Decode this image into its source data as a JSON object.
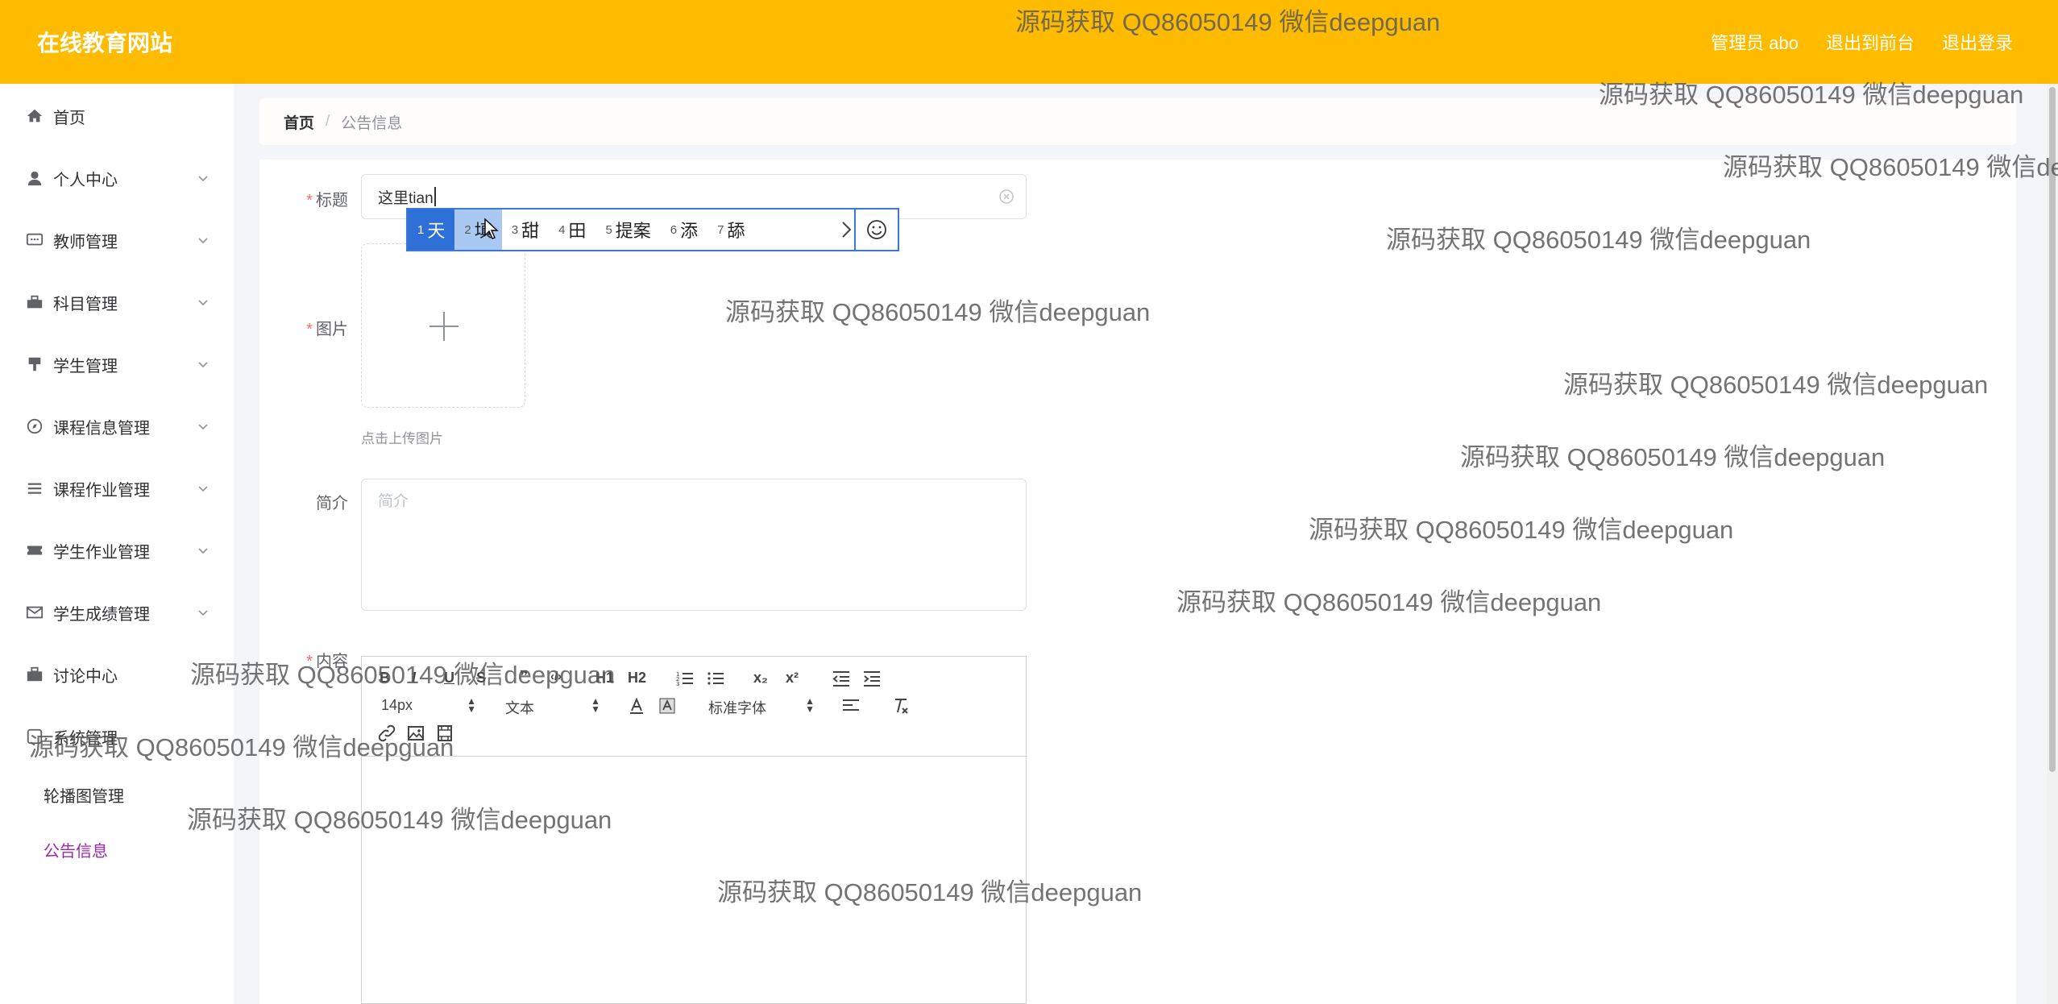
{
  "header": {
    "site_title": "在线教育网站",
    "nav": [
      "管理员 abo",
      "退出到前台",
      "退出登录"
    ]
  },
  "sidebar": {
    "items": [
      {
        "label": "首页",
        "icon": "home-icon"
      },
      {
        "label": "个人中心",
        "icon": "user-icon"
      },
      {
        "label": "教师管理",
        "icon": "chat-icon"
      },
      {
        "label": "科目管理",
        "icon": "briefcase-icon"
      },
      {
        "label": "学生管理",
        "icon": "chair-icon"
      },
      {
        "label": "课程信息管理",
        "icon": "compass-icon"
      },
      {
        "label": "课程作业管理",
        "icon": "list-icon"
      },
      {
        "label": "学生作业管理",
        "icon": "ticket-icon"
      },
      {
        "label": "学生成绩管理",
        "icon": "mail-icon"
      },
      {
        "label": "讨论中心",
        "icon": "bag-icon"
      },
      {
        "label": "系统管理",
        "icon": "settings-icon"
      }
    ],
    "sub_items": [
      "轮播图管理",
      "公告信息"
    ]
  },
  "breadcrumb": {
    "home": "首页",
    "separator": "/",
    "current": "公告信息"
  },
  "form": {
    "title_label": "标题",
    "title_value": "这里tian",
    "image_label": "图片",
    "upload_hint": "点击上传图片",
    "intro_label": "简介",
    "intro_placeholder": "简介",
    "content_label": "内容"
  },
  "editor_toolbar": {
    "buttons_row1": [
      "B",
      "I",
      "U",
      "S",
      "❞",
      "‹/›",
      "H1",
      "H2",
      "ordered-list",
      "bullet-list",
      "x₂",
      "x²",
      "outdent",
      "indent"
    ],
    "size_select": "14px",
    "format_select": "文本",
    "font_select": "标准字体"
  },
  "ime": {
    "candidates": [
      {
        "num": "1",
        "text": "天"
      },
      {
        "num": "2",
        "text": "填"
      },
      {
        "num": "3",
        "text": "甜"
      },
      {
        "num": "4",
        "text": "田"
      },
      {
        "num": "5",
        "text": "提案"
      },
      {
        "num": "6",
        "text": "添"
      },
      {
        "num": "7",
        "text": "舔"
      }
    ]
  },
  "watermark_text": "源码获取 QQ86050149 微信deepguan",
  "colors": {
    "header": "#ffbb00",
    "active_sub": "#9c27b0",
    "required": "#f56c6c",
    "ime_selected": "#2e6fd8"
  }
}
